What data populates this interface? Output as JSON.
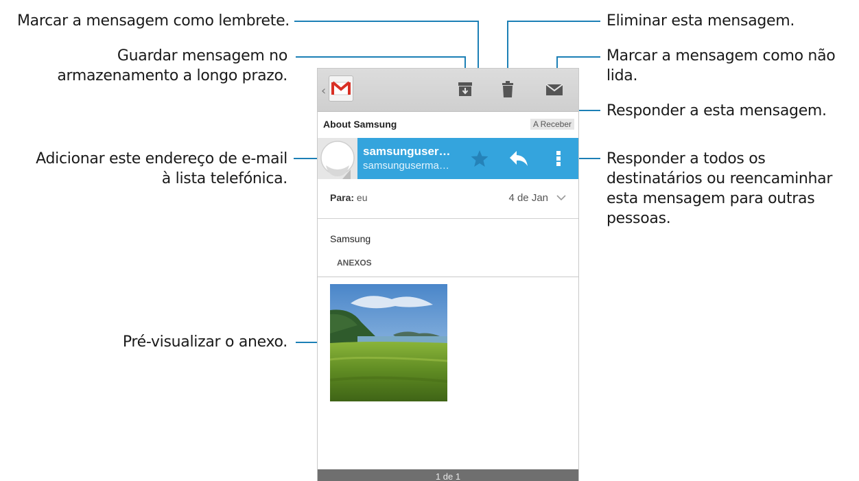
{
  "annotations": {
    "reminder": "Marcar a mensagem como lembrete.",
    "archive_line1": "Guardar mensagem no",
    "archive_line2": "armazenamento a longo prazo.",
    "add_contact_line1": "Adicionar este endereço de e-mail",
    "add_contact_line2": "à lista telefónica.",
    "preview": "Pré-visualizar o anexo.",
    "delete": "Eliminar esta mensagem.",
    "unread_line1": "Marcar a mensagem como não",
    "unread_line2": "lida.",
    "reply": "Responder a esta mensagem.",
    "more_line1": "Responder a todos os",
    "more_line2": "destinatários ou reencaminhar",
    "more_line3": "esta mensagem para outras",
    "more_line4": "pessoas."
  },
  "email": {
    "subject": "About Samsung",
    "label": "A Receber",
    "sender_name": "samsunguser…",
    "sender_email": "samsunguserma…",
    "to_label": "Para:",
    "to_value": "eu",
    "date": "4 de Jan",
    "body": "Samsung",
    "attachments_title": "ANEXOS",
    "pager": "1 de 1"
  },
  "icons": [
    "gmail-logo",
    "archive-icon",
    "trash-icon",
    "mark-unread-icon",
    "star-icon",
    "reply-icon",
    "overflow-menu-icon",
    "chevron-down-icon",
    "avatar-icon"
  ],
  "colors": {
    "accent": "#34a4dd",
    "annotation_line": "#1b7fb5",
    "topbar": "#d4d4d4",
    "footer": "#6f6f6f"
  }
}
